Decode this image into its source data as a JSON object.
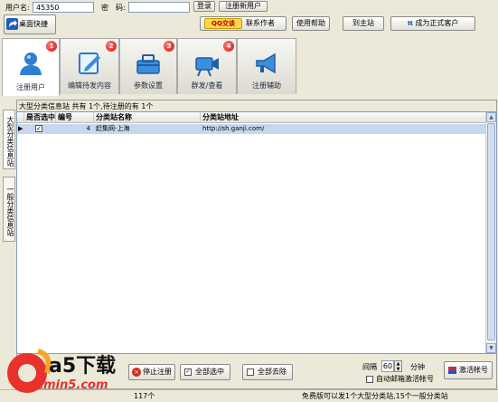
{
  "login": {
    "username_label": "用户名:",
    "username_value": "45350",
    "password_label": "密　码:",
    "password_value": "",
    "login_button": "登录",
    "register_link": "注册新用户"
  },
  "toolbar": {
    "desktop_shortcut": "桌面快捷",
    "qq_badge": "QQ交谈",
    "contact_author": "联系作者",
    "help": "使用帮助",
    "to_main_site": "到主站",
    "become_customer_symbol": "π",
    "become_customer": "成为正式客户"
  },
  "tabs": [
    {
      "label": "注册用户",
      "badge": "1",
      "icon": "user-icon"
    },
    {
      "label": "编辑待发内容",
      "badge": "2",
      "icon": "edit-icon"
    },
    {
      "label": "参数设置",
      "badge": "3",
      "icon": "toolbox-icon"
    },
    {
      "label": "群发/查看",
      "badge": "4",
      "icon": "camera-icon"
    },
    {
      "label": "注册辅助",
      "badge": "",
      "icon": "megaphone-icon"
    }
  ],
  "side_tabs": {
    "large_sites": "大型分类信息站",
    "general_sites": "一般分类信息站"
  },
  "info_line": "大型分类信息站 共有 1个,待注册的有 1个",
  "table": {
    "columns": [
      "是否选中",
      "编号",
      "分类站名称",
      "分类站地址"
    ],
    "rows": [
      {
        "selected": "✓",
        "id": "4",
        "name": "赶集网-上海",
        "url": "http://sh.ganji.com/"
      }
    ]
  },
  "bottom": {
    "stop_register": "停止注册",
    "select_all": "全部选中",
    "deselect_all": "全部去除",
    "interval_label": "间隔",
    "interval_value": "60",
    "interval_unit": "分钟",
    "auto_activate": "自动邮箱激活帐号",
    "activate_account": "激活帐号"
  },
  "status": {
    "left_fragment": "117个",
    "right_text": "免费版可以发1个大型分类站,15个一般分类站"
  },
  "watermark": {
    "brand": "a5下载",
    "site": "admin5.com"
  }
}
